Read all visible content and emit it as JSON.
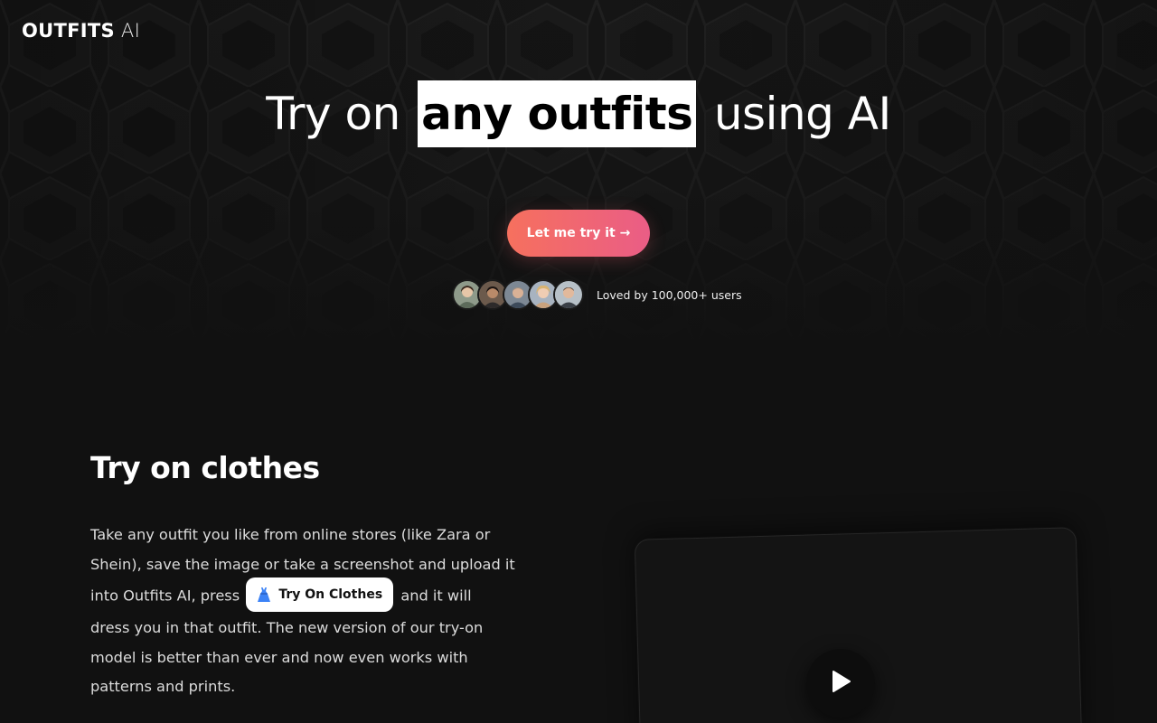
{
  "brand": {
    "name_strong": "OUTFITS",
    "name_light": "AI"
  },
  "hero": {
    "title_before": "Try on",
    "title_highlight": "any outfits",
    "title_after": "using AI",
    "cta_label": "Let me try it →",
    "social_proof": "Loved by 100,000+ users"
  },
  "section": {
    "title": "Try on clothes",
    "text_part1": "Take any outfit you like from online stores (like Zara or Shein), save the image or take a screenshot and upload it into Outfits AI, press",
    "inline_button_label": "Try On Clothes",
    "inline_button_icon": "dress-icon",
    "text_part2": "and it will dress you in that outfit. The new version of our try-on model is better than ever and now even works with patterns and prints."
  },
  "video": {
    "icon": "play-icon"
  },
  "colors": {
    "background": "#111111",
    "cta_gradient_start": "#f6705e",
    "cta_gradient_end": "#ea5d86",
    "highlight_bg": "#ffffff",
    "dress_blue": "#3b82f6"
  }
}
